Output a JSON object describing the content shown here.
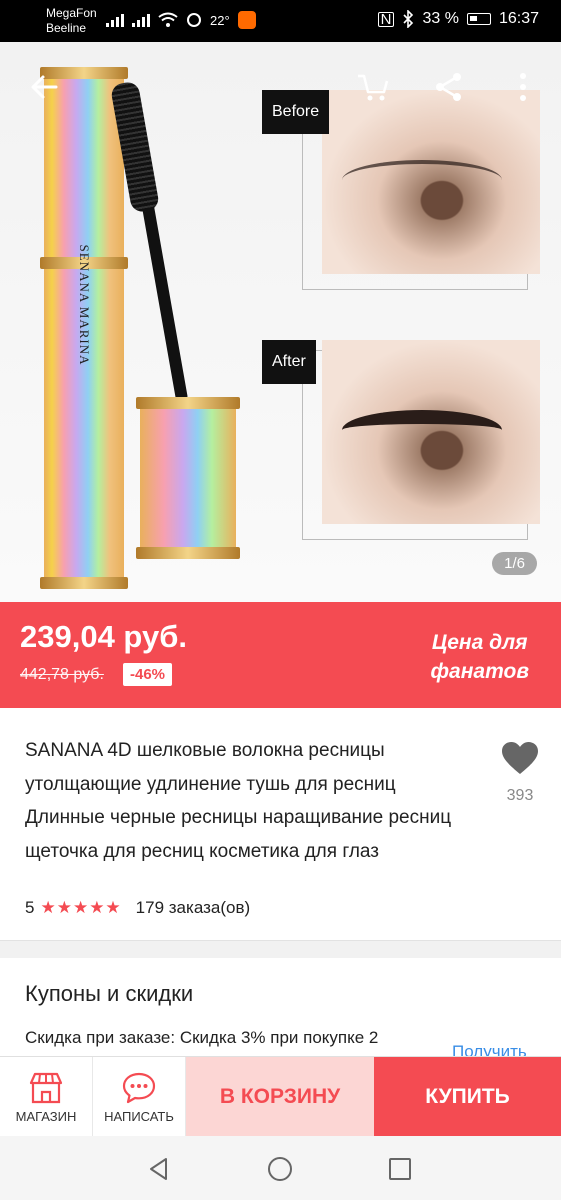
{
  "status_bar": {
    "carrier_1": "MegaFon",
    "carrier_2": "Beeline",
    "temperature": "22°",
    "battery": "33 %",
    "time": "16:37"
  },
  "gallery": {
    "brand_on_product": "SENANA MARINA",
    "before_label": "Before",
    "after_label": "After",
    "counter": "1/6"
  },
  "price_banner": {
    "price": "239,04 руб.",
    "old_price": "442,78 руб.",
    "discount": "-46%",
    "fan_price_line1": "Цена для",
    "fan_price_line2": "фанатов",
    "background": "#f44b52"
  },
  "product": {
    "title": "SANANA 4D шелковые волокна ресницы утолщающие удлинение тушь для ресниц Длинные черные ресницы наращивание ресниц щеточка для ресниц косметика для глаз",
    "favorites_count": "393",
    "rating": "5",
    "stars": "★★★★★",
    "orders": "179 заказа(ов)"
  },
  "coupons": {
    "title": "Купоны и скидки",
    "text": "Скидка при заказе: Скидка 3% при покупке 2",
    "link": "Получить"
  },
  "action_bar": {
    "store_label": "МАГАЗИН",
    "message_label": "НАПИСАТЬ",
    "cart_label": "В КОРЗИНУ",
    "buy_label": "КУПИТЬ"
  }
}
